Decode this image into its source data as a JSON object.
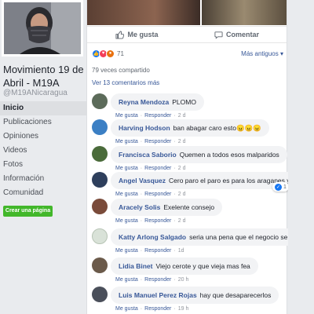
{
  "page": {
    "name": "Movimiento 19 de Abril - M19A",
    "handle": "@M19ANicaragua",
    "create_page_label": "Crear una página"
  },
  "nav": {
    "items": [
      {
        "label": "Inicio",
        "active": true
      },
      {
        "label": "Publicaciones",
        "active": false
      },
      {
        "label": "Opiniones",
        "active": false
      },
      {
        "label": "Videos",
        "active": false
      },
      {
        "label": "Fotos",
        "active": false
      },
      {
        "label": "Información",
        "active": false
      },
      {
        "label": "Comunidad",
        "active": false
      }
    ]
  },
  "post": {
    "like_label": "Me gusta",
    "comment_label": "Comentar",
    "reaction_count": "71",
    "sort_label": "Más antiguos ▾",
    "shares": "79 veces compartido",
    "view_more": "Ver 13 comentarios más"
  },
  "comment_meta": {
    "like": "Me gusta",
    "reply": "Responder"
  },
  "comments": [
    {
      "author": "Reyna Mendoza",
      "text": "PLOMO",
      "time": "2 d",
      "avatar_color": "#5c6b5a"
    },
    {
      "author": "Harving Hodson",
      "text": "ban abagar caro esto😠😠😠",
      "time": "2 d",
      "avatar_color": "#3b7fc4"
    },
    {
      "author": "Francisca Saborio",
      "text": "Quemen a todos esos malparidos",
      "time": "2 d",
      "avatar_color": "#4a6b3a"
    },
    {
      "author": "Angel Vasquez",
      "text": "Cero paro el paro es para los araganes y ladro es",
      "time": "2 d",
      "avatar_color": "#2e3f5c",
      "reactions": "1"
    },
    {
      "author": "Aracely Solis",
      "text": "Exelente consejo",
      "time": "2 d",
      "avatar_color": "#7a4b3a"
    },
    {
      "author": "Katty Arlong Salgado",
      "text": "seria una pena que el negocio se quemara",
      "time": "1d",
      "avatar_color": "#d9e2d8"
    },
    {
      "author": "Lidia Binet",
      "text": "Viejo cerote y que vieja mas fea",
      "time": "20 h",
      "avatar_color": "#6b5a4a"
    },
    {
      "author": "Luis Manuel Perez Rojas",
      "text": "hay que desaparecerlos",
      "time": "19 h",
      "avatar_color": "#4a4f5a"
    }
  ]
}
